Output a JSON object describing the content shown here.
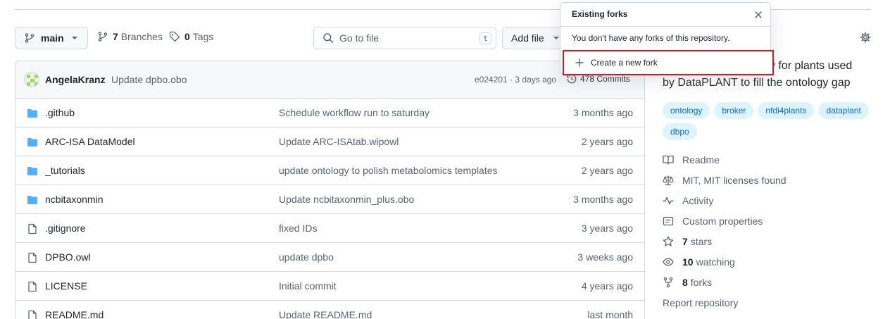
{
  "toolbar": {
    "branch_label": "main",
    "branches_count": "7",
    "branches_label": "Branches",
    "tags_count": "0",
    "tags_label": "Tags",
    "search_placeholder": "Go to file",
    "search_shortcut": "t",
    "add_file_label": "Add file"
  },
  "commit": {
    "author": "AngelaKranz",
    "message": "Update dpbo.obo",
    "hash_time": "e024201 · 3 days ago",
    "commits_label": "478 Commits"
  },
  "files": [
    {
      "name": ".github",
      "type": "folder",
      "message": "Schedule workflow run to saturday",
      "date": "3 months ago"
    },
    {
      "name": "ARC-ISA DataModel",
      "type": "folder",
      "message": "Update ARC-ISAtab.wipowl",
      "date": "2 years ago"
    },
    {
      "name": "_tutorials",
      "type": "folder",
      "message": "update ontology to polish metabolomics templates",
      "date": "2 years ago"
    },
    {
      "name": "ncbitaxonmin",
      "type": "folder",
      "message": "Update ncbitaxonmin_plus.obo",
      "date": "3 months ago"
    },
    {
      "name": ".gitignore",
      "type": "file",
      "message": "fixed IDs",
      "date": "3 years ago"
    },
    {
      "name": "DPBO.owl",
      "type": "file",
      "message": "update dpbo",
      "date": "3 weeks ago"
    },
    {
      "name": "LICENSE",
      "type": "file",
      "message": "Initial commit",
      "date": "4 years ago"
    },
    {
      "name": "README.md",
      "type": "file",
      "message": "Update README.md",
      "date": "last month"
    }
  ],
  "sidebar": {
    "about_line1": "gy for plants used",
    "about_line2": "by DataPLANT to fill the ontology gap",
    "topics": [
      "ontology",
      "broker",
      "nfdi4plants",
      "dataplant",
      "dbpo"
    ],
    "readme": "Readme",
    "license": "MIT, MIT licenses found",
    "activity": "Activity",
    "custom_properties": "Custom properties",
    "stars_count": "7",
    "stars_label": "stars",
    "watching_count": "10",
    "watching_label": "watching",
    "forks_count": "8",
    "forks_label": "forks",
    "report": "Report repository"
  },
  "popup": {
    "title": "Existing forks",
    "message": "You don't have any forks of this repository.",
    "create_label": "Create a new fork"
  },
  "colors": {
    "accent": "#0969da",
    "highlight_border": "#e5141b",
    "folder": "#54aeff"
  }
}
